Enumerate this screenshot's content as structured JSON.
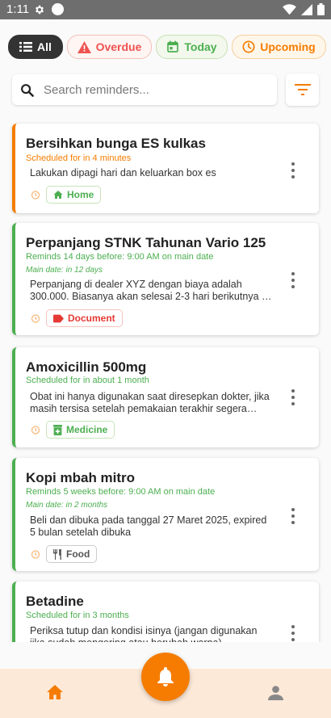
{
  "status_bar": {
    "time": "1:11"
  },
  "filters": {
    "all": "All",
    "overdue": "Overdue",
    "today": "Today",
    "upcoming": "Upcoming"
  },
  "search": {
    "placeholder": "Search reminders..."
  },
  "reminders": [
    {
      "title": "Bersihkan bunga ES kulkas",
      "schedule": "Scheduled for in 4 minutes",
      "description": "Lakukan dipagi hari dan keluarkan box es",
      "tag": "Home"
    },
    {
      "title": "Perpanjang STNK Tahunan Vario 125",
      "schedule": "Reminds 14 days before: 9:00 AM on main date",
      "main_date": "Main date: in 12 days",
      "description": "Perpanjang di dealer XYZ dengan biaya adalah 300.000. Biasanya akan selesai 2-3 hari berikutnya di …",
      "tag": "Document"
    },
    {
      "title": "Amoxicillin 500mg",
      "schedule": "Scheduled for in about 1 month",
      "description": "Obat ini hanya digunakan saat diresepkan dokter, jika masih tersisa setelah pemakaian terakhir segera buat…",
      "tag": "Medicine"
    },
    {
      "title": "Kopi mbah mitro",
      "schedule": "Reminds 5 weeks before: 9:00 AM on main date",
      "main_date": "Main date: in 2 months",
      "description": "Beli dan dibuka pada tanggal 27 Maret 2025, expired 5 bulan setelah dibuka",
      "tag": "Food"
    },
    {
      "title": "Betadine",
      "schedule": "Scheduled for in 3 months",
      "description": "Periksa tutup dan kondisi isinya (jangan digunakan jika sudah mengering atau berubah warna)"
    }
  ],
  "colors": {
    "accent": "#f57c00",
    "green": "#4caf50",
    "red": "#e53935",
    "bottom_bar": "#fde9d8"
  }
}
